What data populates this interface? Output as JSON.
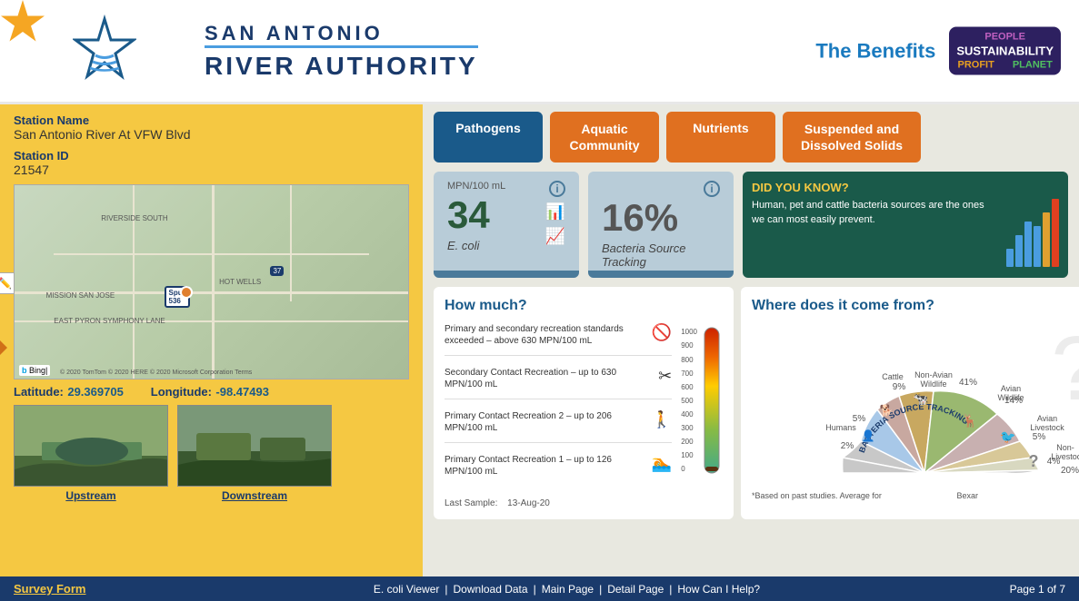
{
  "header": {
    "logo": {
      "line1": "SAN ANTONIO",
      "line2": "RIVER AUTHORITY"
    },
    "benefits_label": "The Benefits",
    "badge": {
      "profit": "PROFIT",
      "sustainability": "SUSTAINABILITY",
      "planet": "PLANET",
      "people": "PEOPLE"
    }
  },
  "station": {
    "name_label": "Station Name",
    "name_value": "San Antonio River At VFW Blvd",
    "id_label": "Station ID",
    "id_value": "21547",
    "lat_label": "Latitude:",
    "lat_value": "29.369705",
    "lon_label": "Longitude:",
    "lon_value": "-98.47493",
    "upstream_label": "Upstream",
    "downstream_label": "Downstream"
  },
  "tabs": [
    {
      "id": "pathogens",
      "label": "Pathogens",
      "active": true
    },
    {
      "id": "aquatic",
      "label": "Aquatic\nCommunity",
      "active": false
    },
    {
      "id": "nutrients",
      "label": "Nutrients",
      "active": false
    },
    {
      "id": "suspended",
      "label": "Suspended and\nDissolved Solids",
      "active": false
    }
  ],
  "stat_ecoli": {
    "unit": "MPN/100 mL",
    "value": "34",
    "name": "E. coli"
  },
  "stat_bacteria": {
    "value": "16%",
    "name": "Bacteria Source Tracking"
  },
  "did_you_know": {
    "title": "DID YOU KNOW?",
    "text": "Human, pet and cattle bacteria sources are the ones we can most easily prevent.",
    "bars": [
      20,
      35,
      50,
      45,
      60,
      75
    ]
  },
  "how_much": {
    "title": "How much?",
    "items": [
      {
        "text": "Primary and secondary recreation standards exceeded – above 630 MPN/100 mL",
        "icon": "🚫"
      },
      {
        "text": "Secondary Contact Recreation – up to 630 MPN/100 mL",
        "icon": "✕"
      },
      {
        "text": "Primary Contact Recreation 2 – up to 206 MPN/100 mL",
        "icon": "🚶"
      },
      {
        "text": "Primary Contact Recreation 1 – up to 126 MPN/100 mL",
        "icon": "🏊"
      }
    ],
    "thermo_labels": [
      "1000",
      "900",
      "800",
      "700",
      "600",
      "500",
      "400",
      "300",
      "200",
      "100",
      "0"
    ],
    "last_sample_label": "Last Sample:",
    "last_sample_value": "13-Aug-20"
  },
  "where_from": {
    "title": "Where does it come from?",
    "segments": [
      {
        "label": "Cattle",
        "pct": "9%",
        "color": "#c8a860"
      },
      {
        "label": "Non-Avian Wildlife",
        "pct": "41%",
        "color": "#9ab870"
      },
      {
        "label": "Avian Wildlife",
        "pct": "14%",
        "color": "#c8a8a8"
      },
      {
        "label": "Avian Livestock",
        "pct": "5%",
        "color": "#d8c898"
      },
      {
        "label": "Non-Livestock",
        "pct": "4%",
        "color": "#d8d8c0"
      },
      {
        "label": "Unidentified",
        "pct": "20%",
        "color": "#c8c8c8"
      },
      {
        "label": "Humans",
        "pct": "2%",
        "color": "#a8c8e8"
      },
      {
        "label": "Pets",
        "pct": "5%",
        "color": "#d0b8a8"
      }
    ],
    "center_label": "BACTERIA SOURCE TRACKING",
    "footnote": "*Based on past studies. Average for",
    "footnote2": "Bexar"
  },
  "footer": {
    "survey_label": "Survey Form",
    "links": [
      "E. coli Viewer",
      "Download Data",
      "Main Page",
      "Detail Page",
      "How Can I Help?"
    ],
    "page_label": "Page 1 of 7"
  }
}
